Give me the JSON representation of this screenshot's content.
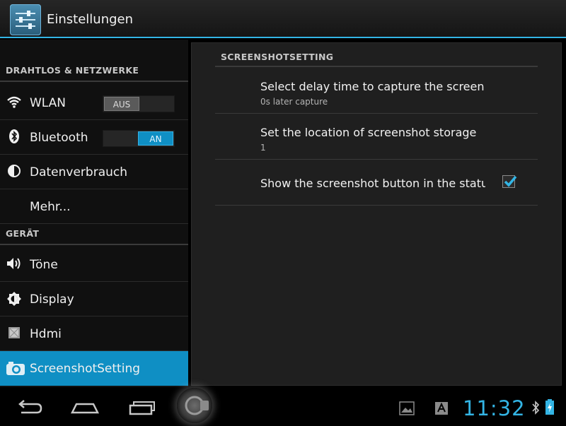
{
  "actionbar": {
    "title": "Einstellungen",
    "icon": "settings-sliders-icon"
  },
  "left": {
    "sections": [
      {
        "header": "DRAHTLOS & NETZWERKE"
      },
      {
        "header": "GERÄT"
      }
    ],
    "items": [
      {
        "label": "WLAN",
        "icon": "wifi-icon",
        "toggle": "AUS"
      },
      {
        "label": "Bluetooth",
        "icon": "bluetooth-icon",
        "toggle": "AN"
      },
      {
        "label": "Datenverbrauch",
        "icon": "data-usage-icon"
      },
      {
        "label": "Mehr..."
      },
      {
        "label": "Töne",
        "icon": "speaker-icon"
      },
      {
        "label": "Display",
        "icon": "brightness-icon"
      },
      {
        "label": "Hdmi",
        "icon": "hdmi-icon"
      },
      {
        "label": "ScreenshotSetting",
        "icon": "camera-icon",
        "selected": true
      }
    ]
  },
  "right": {
    "header": "SCREENSHOTSETTING",
    "prefs": [
      {
        "title": "Select delay time to capture the screen",
        "summary": "0s later capture"
      },
      {
        "title": "Set the location of screenshot storage",
        "summary": "1"
      },
      {
        "title": "Show the screenshot button in the status",
        "checked": true
      }
    ]
  },
  "statusbar": {
    "clock": "11:32",
    "accent_color": "#33b5e5",
    "icons": [
      "back-icon",
      "home-icon",
      "recent-apps-icon",
      "screenshot-camera-icon",
      "gallery-notification-icon",
      "keyboard-notification-icon",
      "bluetooth-status-icon",
      "battery-charging-icon"
    ]
  }
}
